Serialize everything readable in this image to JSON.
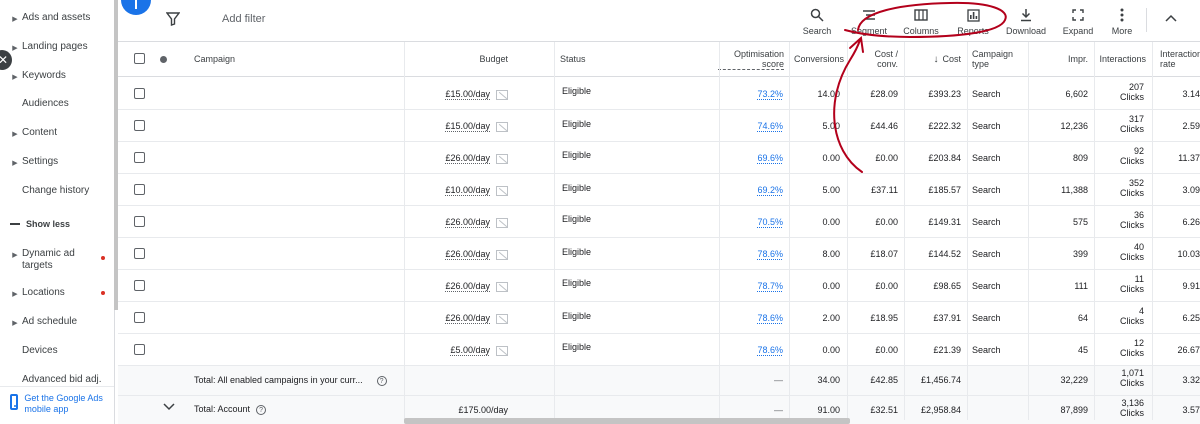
{
  "sidebar": {
    "items": [
      {
        "label": "Ads and assets",
        "caret": true
      },
      {
        "label": "Landing pages",
        "caret": true
      },
      {
        "label": "Keywords",
        "caret": true
      },
      {
        "label": "Audiences",
        "caret": false
      },
      {
        "label": "Content",
        "caret": true
      },
      {
        "label": "Settings",
        "caret": true
      },
      {
        "label": "Change history",
        "caret": false
      },
      {
        "label": "Dynamic ad targets",
        "caret": true
      },
      {
        "label": "Locations",
        "caret": true
      },
      {
        "label": "Ad schedule",
        "caret": true
      },
      {
        "label": "Devices",
        "caret": false
      },
      {
        "label": "Advanced bid adj.",
        "caret": false
      }
    ],
    "show_less": "Show less",
    "mobile_app": "Get the Google Ads mobile app"
  },
  "toolbar": {
    "add_filter": "Add filter",
    "tools": [
      {
        "label": "Search",
        "icon": "search-icon"
      },
      {
        "label": "Segment",
        "icon": "segment-icon"
      },
      {
        "label": "Columns",
        "icon": "columns-icon"
      },
      {
        "label": "Reports",
        "icon": "reports-icon"
      },
      {
        "label": "Download",
        "icon": "download-icon"
      },
      {
        "label": "Expand",
        "icon": "expand-icon"
      },
      {
        "label": "More",
        "icon": "more-icon"
      }
    ]
  },
  "table": {
    "headers": {
      "campaign": "Campaign",
      "budget": "Budget",
      "status": "Status",
      "opt_score": "Optimisation score",
      "conversions": "Conversions",
      "cost_conv": "Cost / conv.",
      "cost": "Cost",
      "campaign_type": "Campaign type",
      "impr": "Impr.",
      "interactions": "Interactions",
      "interaction_rate": "Interaction rate"
    },
    "rows": [
      {
        "budget": "£15.00/day",
        "status": "Eligible",
        "opt": "73.2%",
        "conv": "14.00",
        "cost_conv": "£28.09",
        "cost": "£393.23",
        "type": "Search",
        "impr": "6,602",
        "inter": "207",
        "inter_unit": "Clicks",
        "rate": "3.14"
      },
      {
        "budget": "£15.00/day",
        "status": "Eligible",
        "opt": "74.6%",
        "conv": "5.00",
        "cost_conv": "£44.46",
        "cost": "£222.32",
        "type": "Search",
        "impr": "12,236",
        "inter": "317",
        "inter_unit": "Clicks",
        "rate": "2.59"
      },
      {
        "budget": "£26.00/day",
        "status": "Eligible",
        "opt": "69.6%",
        "conv": "0.00",
        "cost_conv": "£0.00",
        "cost": "£203.84",
        "type": "Search",
        "impr": "809",
        "inter": "92",
        "inter_unit": "Clicks",
        "rate": "11.37"
      },
      {
        "budget": "£10.00/day",
        "status": "Eligible",
        "opt": "69.2%",
        "conv": "5.00",
        "cost_conv": "£37.11",
        "cost": "£185.57",
        "type": "Search",
        "impr": "11,388",
        "inter": "352",
        "inter_unit": "Clicks",
        "rate": "3.09"
      },
      {
        "budget": "£26.00/day",
        "status": "Eligible",
        "opt": "70.5%",
        "conv": "0.00",
        "cost_conv": "£0.00",
        "cost": "£149.31",
        "type": "Search",
        "impr": "575",
        "inter": "36",
        "inter_unit": "Clicks",
        "rate": "6.26"
      },
      {
        "budget": "£26.00/day",
        "status": "Eligible",
        "opt": "78.6%",
        "conv": "8.00",
        "cost_conv": "£18.07",
        "cost": "£144.52",
        "type": "Search",
        "impr": "399",
        "inter": "40",
        "inter_unit": "Clicks",
        "rate": "10.03"
      },
      {
        "budget": "£26.00/day",
        "status": "Eligible",
        "opt": "78.7%",
        "conv": "0.00",
        "cost_conv": "£0.00",
        "cost": "£98.65",
        "type": "Search",
        "impr": "111",
        "inter": "11",
        "inter_unit": "Clicks",
        "rate": "9.91"
      },
      {
        "budget": "£26.00/day",
        "status": "Eligible",
        "opt": "78.6%",
        "conv": "2.00",
        "cost_conv": "£18.95",
        "cost": "£37.91",
        "type": "Search",
        "impr": "64",
        "inter": "4",
        "inter_unit": "Clicks",
        "rate": "6.25"
      },
      {
        "budget": "£5.00/day",
        "status": "Eligible",
        "opt": "78.6%",
        "conv": "0.00",
        "cost_conv": "£0.00",
        "cost": "£21.39",
        "type": "Search",
        "impr": "45",
        "inter": "12",
        "inter_unit": "Clicks",
        "rate": "26.67"
      }
    ],
    "total_enabled": {
      "label": "Total: All enabled campaigns in your curr...",
      "opt": "—",
      "conv": "34.00",
      "cost_conv": "£42.85",
      "cost": "£1,456.74",
      "impr": "32,229",
      "inter": "1,071",
      "inter_unit": "Clicks",
      "rate": "3.32"
    },
    "total_account": {
      "label": "Total: Account",
      "budget": "£175.00/day",
      "opt": "—",
      "conv": "91.00",
      "cost_conv": "£32.51",
      "cost": "£2,958.84",
      "impr": "87,899",
      "inter": "3,136",
      "inter_unit": "Clicks",
      "rate": "3.57"
    }
  },
  "colors": {
    "accent": "#1a73e8",
    "annotation": "#b3001b",
    "alert_dot": "#d93025"
  }
}
